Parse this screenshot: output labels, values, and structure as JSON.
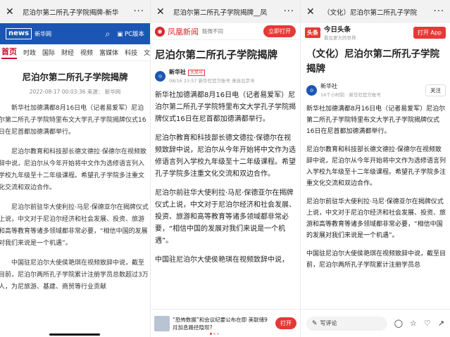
{
  "panel1": {
    "wx_title": "尼泊尔第二所孔子学院揭牌-新华",
    "close": "✕",
    "more": "···",
    "logo": "新华网",
    "pc_label": "PC版本",
    "nav": [
      "首页",
      "时政",
      "国际",
      "财经",
      "视频",
      "富媒体",
      "科技",
      "文"
    ],
    "title": "尼泊尔第二所孔子学院揭牌",
    "meta": "2022-08-17 00:03:36 来源： 新华网",
    "paragraphs": [
      "新华社加德满都8月16日电（记者易爱军）尼泊尔第二所孔子学院特里布文大学孔子学院揭牌仪式16日在尼首都加德满都举行。",
      "尼泊尔教育和科技部长德文德拉·保德尔在视频致辞中说，尼泊尔从今年开始将中文作为选修语言列入学校九年级至十二年级课程。希望孔子学院多注重文化交流和双边合作。",
      "尼泊尔前驻华大使利拉·马尼·保德亚尔在揭牌仪式上说，中文对于尼泊尔经济和社会发展、投资、旅游和高等教育等诸多领域都非常必要，“相信中国的发展对我们来说是一个机遇”。",
      "中国驻尼泊尔大使侯艳琪在视频致辞中说，截至目前，尼泊尔两所孔子学院累计注册学员总数超过3万人，为尼旅游、基建、商贸等行业贡献"
    ]
  },
  "panel2": {
    "wx_title": "尼泊尔第二所孔子学院揭牌__凤",
    "close": "✕",
    "more": "···",
    "brand": "凤凰新闻",
    "slogan": "既微不同",
    "open_label": "立即打开",
    "title": "尼泊尔第二所孔子学院揭牌",
    "source": "新华社",
    "badge": "大凤号",
    "meta": "08/16 23:57  新华社官方账号  来自北京市",
    "paragraphs": [
      "新华社加德满都8月16日电（记者易爱军）尼泊尔第二所孔子学院特里布文大学孔子学院揭牌仪式16日在尼首都加德满都举行。",
      "尼泊尔教育和科技部长德文德拉·保德尔在视频致辞中说，尼泊尔从今年开始将中文作为选修语言列入学校九年级至十二年级课程。希望孔子学院多注重文化交流和双边合作。",
      "尼泊尔前驻华大使利拉·马尼·保德亚尔在揭牌仪式上说，中文对于尼泊尔经济和社会发展、投资、旅游和高等教育等诸多领域都非常必要，“相信中国的发展对我们来说是一个机遇”。",
      "中国驻尼泊尔大使侯艳琪在视频致辞中说，"
    ],
    "ad_text": "“恐怖数据”和会议纪要公布在即 美联储9月加息路径隐现?",
    "ad_open": "打开"
  },
  "panel3": {
    "wx_title": "（文化）尼泊尔第二所孔子学院",
    "close": "✕",
    "more": "···",
    "logo": "头条",
    "app_name": "今日头条",
    "app_sub": "看见更大的世界",
    "open_label": "打开 App",
    "title": "（文化）尼泊尔第二所孔子学院揭牌",
    "source": "新华社",
    "meta": "16个小时前 · 新华社官方账号",
    "follow": "关注",
    "paragraphs": [
      "新华社加德满都8月16日电（记者易爱军）尼泊尔第二所孔子学院特里布文大学孔子学院揭牌仪式16日在尼首都加德满都举行。",
      "尼泊尔教育和科技部长德文德拉·保德尔在视频致辞中说，尼泊尔从今年开始将中文作为选修语言列入学校九年级至十二年级课程。希望孔子学院多注重文化交流和双边合作。",
      "尼泊尔前驻华大使利拉·马尼·保德亚尔在揭牌仪式上说，中文对于尼泊尔经济和社会发展、投资、旅游和高等教育等诸多领域都非常必要，“相信中国的发展对我们来说是一个机遇”。",
      "中国驻尼泊尔大使侯艳琪在视频致辞中说，截至目前，尼泊尔两所孔子学院累计注册学员总"
    ],
    "comment_placeholder": "写评论"
  },
  "colors": {
    "xinhua_blue": "#1b56b4",
    "accent_red": "#e53935"
  }
}
